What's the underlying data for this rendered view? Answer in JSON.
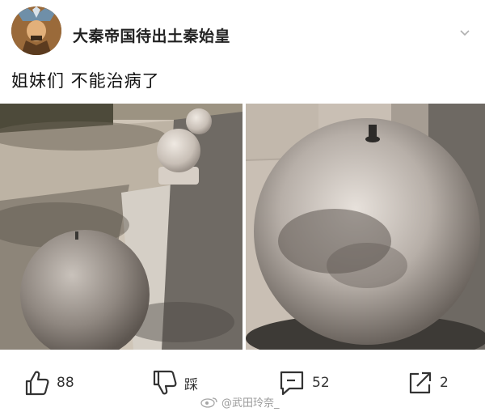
{
  "post": {
    "username": "大秦帝国待出土秦始皇",
    "text": "姐妹们 不能治病了"
  },
  "actions": {
    "like_count": "88",
    "dislike_label": "踩",
    "comment_count": "52",
    "share_count": "2"
  },
  "watermark": {
    "text": "@武田玲奈_"
  },
  "icons": {
    "like": "thumbs-up-icon",
    "dislike": "thumbs-down-icon",
    "comment": "comment-icon",
    "share": "share-icon",
    "more": "chevron-down-icon"
  }
}
